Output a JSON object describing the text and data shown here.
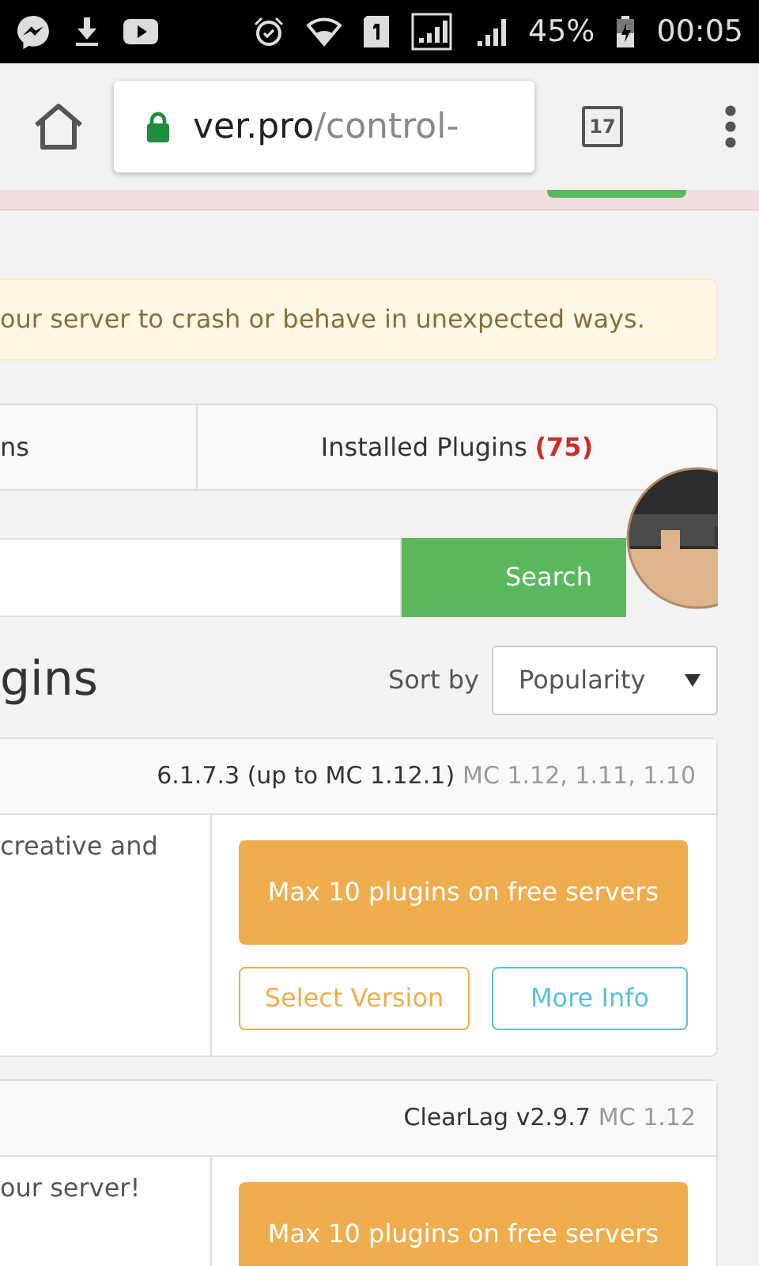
{
  "status_bar": {
    "battery": "45%",
    "time": "00:05"
  },
  "browser": {
    "url_host": "ver.pro",
    "url_path": "/control-",
    "tab_count": "17"
  },
  "alert": {
    "text": "our server to crash or behave in unexpected ways."
  },
  "tabs": [
    {
      "label": "ns",
      "selected": false
    },
    {
      "label": "Installed Plugins",
      "count": "(75)",
      "selected": false
    }
  ],
  "search": {
    "button": "Search"
  },
  "heading": "gins",
  "sort": {
    "label": "Sort by",
    "value": "Popularity"
  },
  "plugins": [
    {
      "version": "6.1.7.3 (up to MC 1.12.1)",
      "mc": "MC 1.12, 1.11, 1.10",
      "description": "creative and",
      "primary": "Max 10 plugins on free servers",
      "actions": [
        {
          "label": "Select Version",
          "kind": "warning"
        },
        {
          "label": "More Info",
          "kind": "info"
        }
      ]
    },
    {
      "version": "ClearLag v2.9.7",
      "mc": "MC 1.12",
      "description": "our server!",
      "primary": "Max 10 plugins on free servers"
    }
  ]
}
